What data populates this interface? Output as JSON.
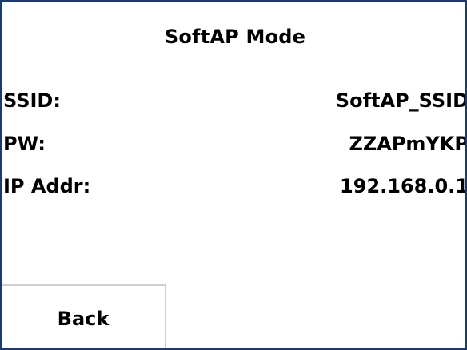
{
  "screen": {
    "title": "SoftAP Mode",
    "border_color": "#1c3a6b",
    "background": "#ffffff"
  },
  "info": {
    "ssid": {
      "label": "SSID:",
      "value": "SoftAP_SSID"
    },
    "pw": {
      "label": "PW:",
      "value": "ZZAPmYKP"
    },
    "ip": {
      "label": "IP Addr:",
      "value": "192.168.0.1"
    }
  },
  "actions": {
    "back_label": "Back"
  }
}
